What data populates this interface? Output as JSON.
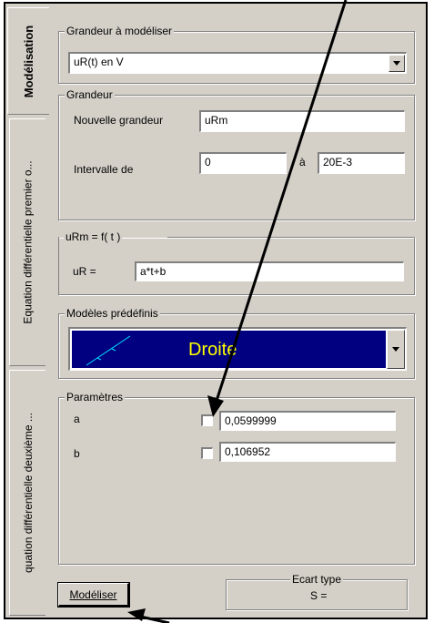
{
  "tabs": [
    {
      "label": "Modélisation",
      "active": true
    },
    {
      "label": "Equation différentielle premier o...",
      "active": false
    },
    {
      "label": "quation différentielle deuxième ...",
      "active": false
    }
  ],
  "grandeur_a_modeliser": {
    "legend": "Grandeur à modéliser",
    "selected": "uR(t) en V"
  },
  "grandeur": {
    "legend": "Grandeur",
    "nouvelle_label": "Nouvelle grandeur",
    "nouvelle_value": "uRm",
    "intervalle_label": "Intervalle de",
    "intervalle_from": "0",
    "a_label": "à",
    "intervalle_to": "20E-3"
  },
  "expression": {
    "legend": "uRm = f( t )",
    "label": "uR =",
    "value": "a*t+b"
  },
  "modeles": {
    "legend": "Modèles prédéfinis",
    "selected": "Droite",
    "accent": "#000080",
    "text_color": "#ffff00"
  },
  "parametres": {
    "legend": "Paramètres",
    "items": [
      {
        "name": "a",
        "checked": false,
        "value": "0,0599999"
      },
      {
        "name": "b",
        "checked": false,
        "value": "0,106952"
      }
    ]
  },
  "bottom": {
    "modeliser_label": "Modéliser",
    "ecart_legend": "Ecart type",
    "ecart_value": "S ="
  }
}
